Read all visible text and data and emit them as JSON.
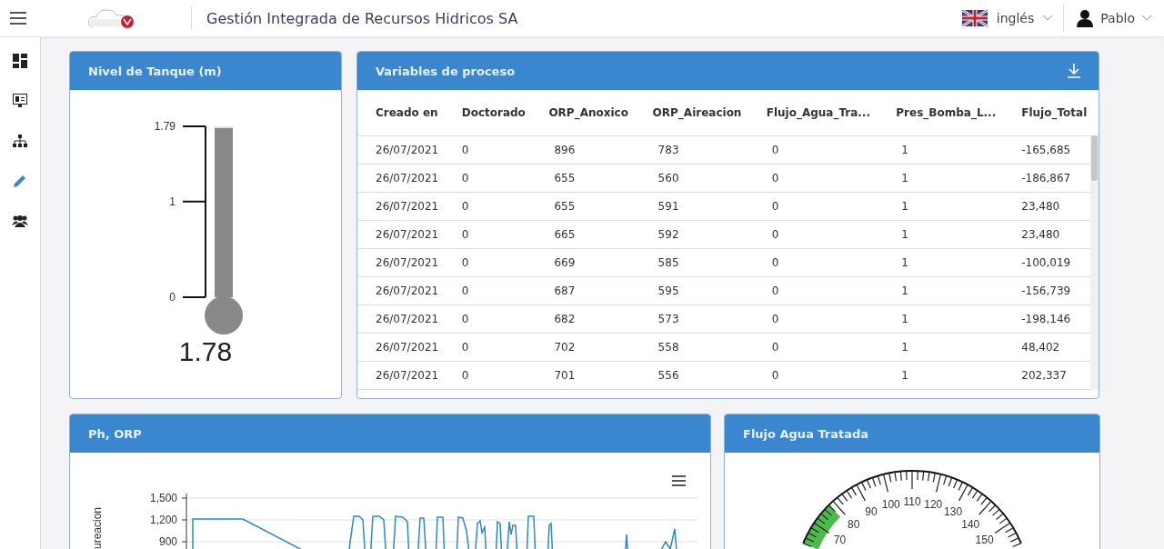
{
  "header": {
    "company": "Gestión Integrada de Recursos Hidricos SA",
    "language": "inglés",
    "user": "Pablo"
  },
  "sidebar": {
    "items": [
      {
        "selected": false
      },
      {
        "selected": false
      },
      {
        "selected": false
      },
      {
        "selected": true
      },
      {
        "selected": false
      }
    ]
  },
  "tank": {
    "title": "Nivel de Tanque (m)",
    "ticks": [
      "1.79",
      "1",
      "0"
    ],
    "level": 0.99,
    "reading": "1.78"
  },
  "process": {
    "title": "Variables de proceso",
    "columns": [
      "Creado en",
      "Doctorado",
      "ORP_Anoxico",
      "ORP_Aireacion",
      "Flujo_Agua_Tra...",
      "Pres_Bomba_L...",
      "Flujo_Total"
    ],
    "rows": [
      [
        "26/07/2021",
        "0",
        "896",
        "783",
        "0",
        "1",
        "-165,685"
      ],
      [
        "26/07/2021",
        "0",
        "655",
        "560",
        "0",
        "1",
        "-186,867"
      ],
      [
        "26/07/2021",
        "0",
        "655",
        "591",
        "0",
        "1",
        "23,480"
      ],
      [
        "26/07/2021",
        "0",
        "665",
        "592",
        "0",
        "1",
        "23,480"
      ],
      [
        "26/07/2021",
        "0",
        "669",
        "585",
        "0",
        "1",
        "-100,019"
      ],
      [
        "26/07/2021",
        "0",
        "687",
        "595",
        "0",
        "1",
        "-156,739"
      ],
      [
        "26/07/2021",
        "0",
        "682",
        "573",
        "0",
        "1",
        "-198,146"
      ],
      [
        "26/07/2021",
        "0",
        "702",
        "558",
        "0",
        "1",
        "48,402"
      ],
      [
        "26/07/2021",
        "0",
        "701",
        "556",
        "0",
        "1",
        "202,337"
      ]
    ]
  },
  "ph_orp": {
    "title": "Ph, ORP",
    "axis_title": "ureacion",
    "yticks": [
      "1,500",
      "1,200",
      "900"
    ]
  },
  "flow": {
    "title": "Flujo Agua Tratada",
    "gauge_labels": [
      "70",
      "80",
      "90",
      "100",
      "110",
      "120",
      "130",
      "140",
      "150"
    ]
  }
}
